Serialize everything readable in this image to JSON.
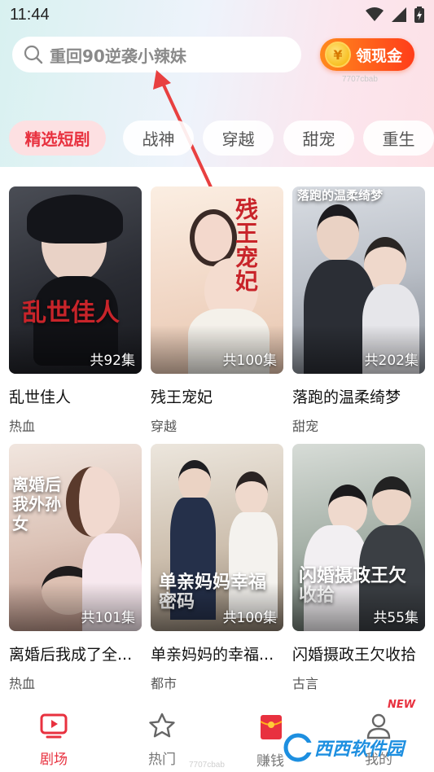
{
  "status_bar": {
    "time": "11:44"
  },
  "search": {
    "placeholder_text": "重回90逆袭小辣妹"
  },
  "cash_button": {
    "coin": "¥",
    "label": "领现金"
  },
  "watermark_top": "7707cbab",
  "tabs": [
    {
      "label": "精选短剧",
      "active": true
    },
    {
      "label": "战神",
      "active": false
    },
    {
      "label": "穿越",
      "active": false
    },
    {
      "label": "甜宠",
      "active": false
    },
    {
      "label": "重生",
      "active": false
    }
  ],
  "dramas": [
    {
      "title": "乱世佳人",
      "tag": "热血",
      "episodes": "共92集",
      "poster_art": "乱世佳人"
    },
    {
      "title": "残王宠妃",
      "tag": "穿越",
      "episodes": "共100集",
      "poster_art": "残王宠妃"
    },
    {
      "title": "落跑的温柔绮梦",
      "tag": "甜宠",
      "episodes": "共202集",
      "poster_art": "落跑的温柔绮梦"
    },
    {
      "title": "离婚后我成了全...",
      "tag": "热血",
      "episodes": "共101集",
      "poster_art": "离婚后我外孙女"
    },
    {
      "title": "单亲妈妈的幸福...",
      "tag": "都市",
      "episodes": "共100集",
      "poster_art": "单亲妈妈幸福密码"
    },
    {
      "title": "闪婚摄政王欠收拾",
      "tag": "古言",
      "episodes": "共55集",
      "poster_art": "闪婚摄政王欠收拾"
    }
  ],
  "bottom_nav": [
    {
      "label": "剧场",
      "icon": "tv-icon",
      "active": true
    },
    {
      "label": "热门",
      "icon": "star-icon",
      "active": false
    },
    {
      "label": "赚钱",
      "icon": "red-packet-icon",
      "active": false
    },
    {
      "label": "我的",
      "icon": "user-icon",
      "active": false
    }
  ],
  "new_badge": "NEW",
  "site_watermark": "西西软件园",
  "watermark_bottom": "7707cbab"
}
